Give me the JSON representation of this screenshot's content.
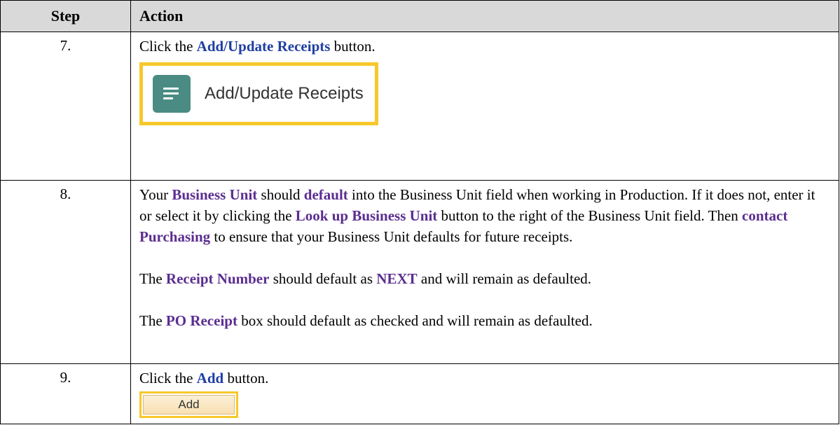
{
  "headers": {
    "step": "Step",
    "action": "Action"
  },
  "step7": {
    "number": "7.",
    "pre": "Click the ",
    "button_ref": "Add/Update Receipts",
    "post": " button.",
    "image_label": "Add/Update Receipts",
    "image_icon": "list-lines-icon",
    "icon_color": "#4a8c83",
    "highlight_color": "#f7c82b"
  },
  "step8": {
    "number": "8.",
    "p1": {
      "t1": "Your ",
      "b1": "Business Unit",
      "t2": " should ",
      "b2": "default",
      "t3": " into the Business Unit field when working in Production. If it does not, enter it or select it by clicking the ",
      "b3": "Look up Business Unit",
      "t4": " button to the right of the Business Unit field. Then ",
      "b4": "contact Purchasing",
      "t5": " to ensure that your Business Unit defaults for future receipts."
    },
    "p2": {
      "t1": "The ",
      "b1": "Receipt Number",
      "t2": " should default as ",
      "b2": "NEXT",
      "t3": " and will remain as defaulted."
    },
    "p3": {
      "t1": "The ",
      "b1": "PO Receipt",
      "t2": " box should default as checked and will remain as defaulted."
    }
  },
  "step9": {
    "number": "9.",
    "pre": "Click the ",
    "button_ref": "Add",
    "post": " button.",
    "image_label": "Add"
  }
}
